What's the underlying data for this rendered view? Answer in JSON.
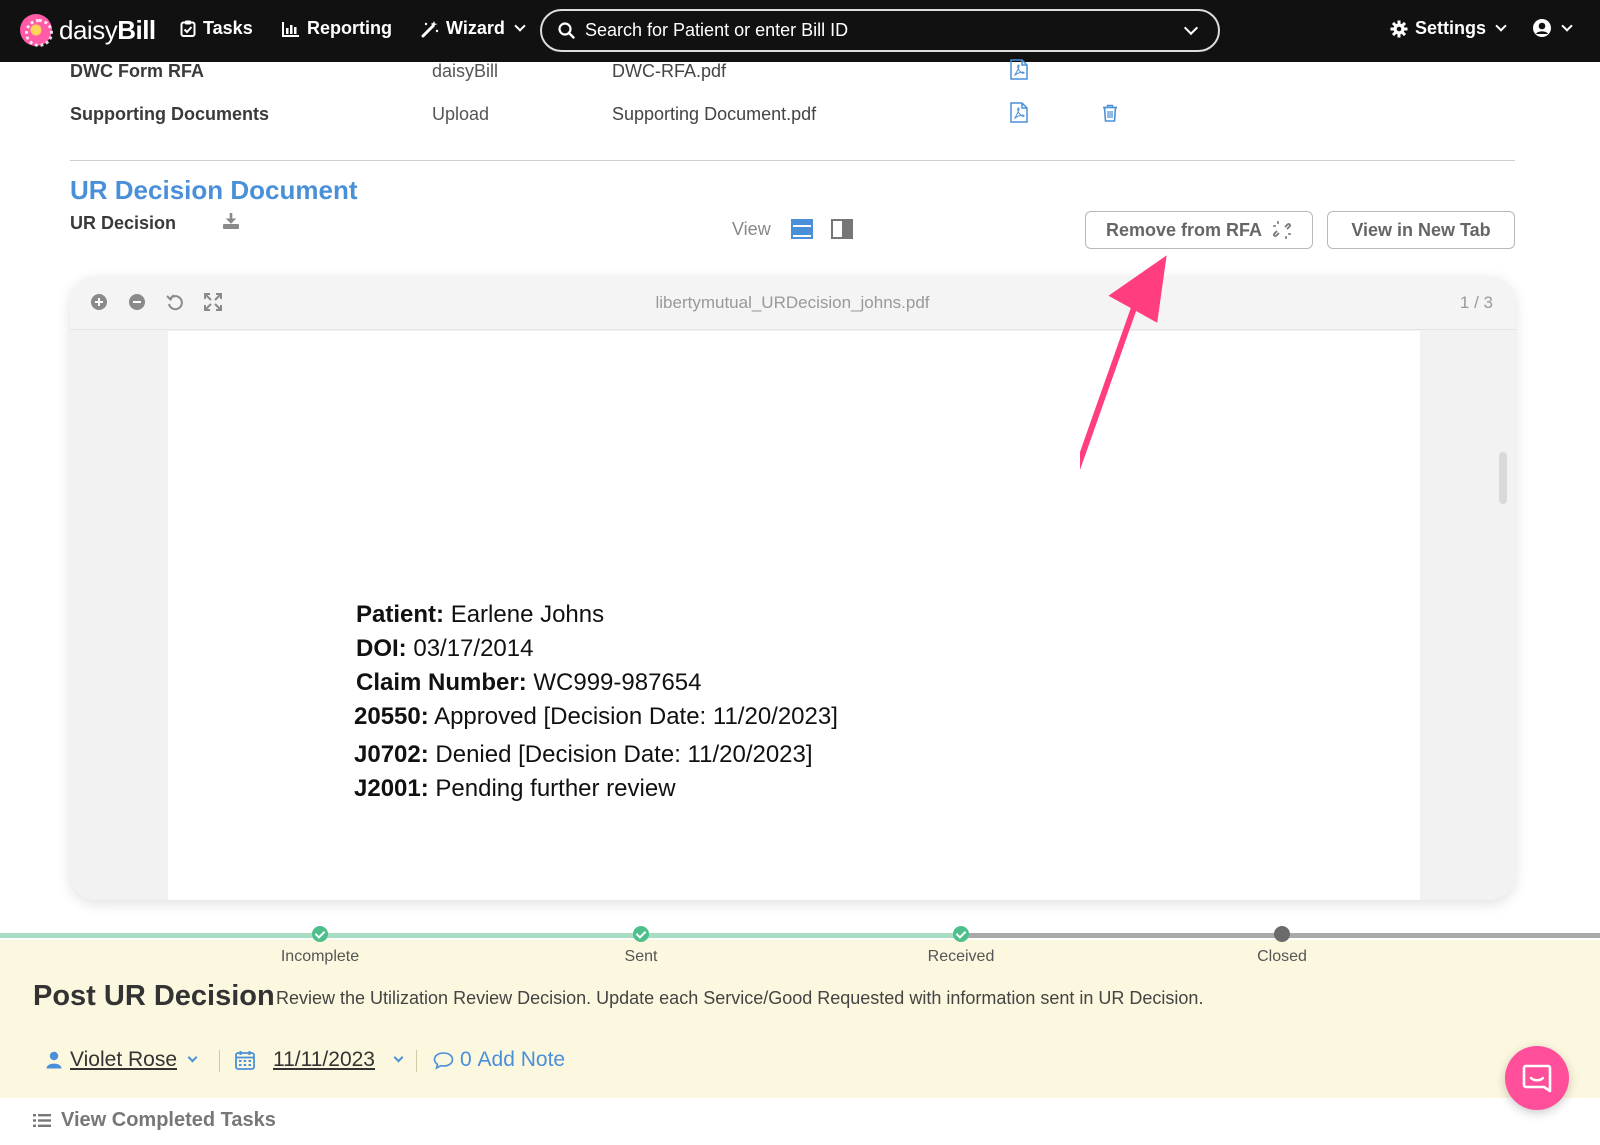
{
  "navbar": {
    "brand_prefix": "daisy",
    "brand_suffix": "Bill",
    "tasks": "Tasks",
    "reporting": "Reporting",
    "wizard": "Wizard",
    "search_placeholder": "Search for Patient or enter Bill ID",
    "settings": "Settings"
  },
  "documents": [
    {
      "name": "DWC Form RFA",
      "source": "daisyBill",
      "file": "DWC-RFA.pdf"
    },
    {
      "name": "Supporting Documents",
      "source": "Upload",
      "file": "Supporting Document.pdf"
    }
  ],
  "ur_section": {
    "title": "UR Decision Document",
    "label": "UR Decision",
    "view_label": "View",
    "remove_button": "Remove from RFA",
    "new_tab_button": "View in New Tab"
  },
  "viewer": {
    "filename": "libertymutual_URDecision_johns.pdf",
    "page_indicator": "1 / 3",
    "lines": [
      {
        "label": "Patient:",
        "value": "Earlene Johns"
      },
      {
        "label": "DOI:",
        "value": "03/17/2014"
      },
      {
        "label": "Claim Number:",
        "value": "WC999-987654"
      },
      {
        "label": "20550:",
        "value": "Approved [Decision Date: 11/20/2023]"
      },
      {
        "label": "J0702:",
        "value": "Denied [Decision Date: 11/20/2023]"
      },
      {
        "label": "J2001:",
        "value": "Pending further review"
      }
    ]
  },
  "progress": {
    "steps": [
      {
        "label": "Incomplete",
        "state": "done"
      },
      {
        "label": "Sent",
        "state": "done"
      },
      {
        "label": "Received",
        "state": "done"
      },
      {
        "label": "Closed",
        "state": "pending"
      }
    ]
  },
  "task": {
    "title": "Post UR Decision",
    "description": "Review the Utilization Review Decision. Update each Service/Good Requested with information sent in UR Decision.",
    "assignee": "Violet Rose",
    "date": "11/11/2023",
    "note_count": "0",
    "note_label": "Add Note"
  },
  "footer": {
    "completed_label": "View Completed Tasks"
  },
  "colors": {
    "accent": "#4a90d9",
    "navbar": "#111111",
    "task_bg": "#fcf7df",
    "arrow": "#ff3d7f",
    "step_done": "#4dbf8a",
    "chat": "#ff4f9b"
  },
  "icons": [
    "tasks-icon",
    "reporting-icon",
    "wizard-icon",
    "search-icon",
    "gear-icon",
    "user-circle-icon",
    "pdf-icon",
    "trash-icon",
    "download-icon",
    "view-horizontal-icon",
    "view-split-icon",
    "unlink-icon",
    "zoom-in-icon",
    "zoom-out-icon",
    "rotate-icon",
    "fullscreen-icon",
    "user-icon",
    "calendar-icon",
    "comment-icon",
    "list-icon",
    "chat-icon"
  ]
}
